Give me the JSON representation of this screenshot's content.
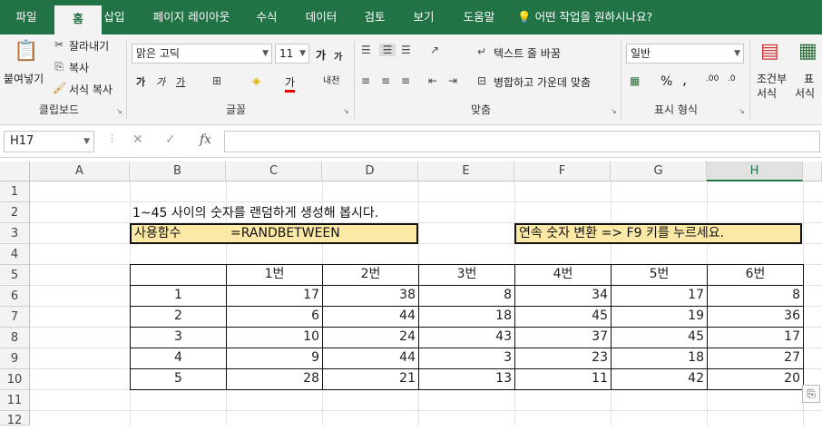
{
  "tabs": [
    "파일",
    "홈",
    "삽입",
    "페이지 레이아웃",
    "수식",
    "데이터",
    "검토",
    "보기",
    "도움말"
  ],
  "tell_me": "어떤 작업을 원하시나요?",
  "clipboard": {
    "paste": "붙여넣기",
    "cut": "잘라내기",
    "copy": "복사",
    "format_painter": "서식 복사",
    "label": "클립보드"
  },
  "font": {
    "name": "맑은 고딕",
    "size": "11",
    "grow": "가",
    "shrink": "가",
    "bold": "가",
    "italic": "가",
    "underline": "가",
    "label": "글꼴",
    "phonetic": "내천"
  },
  "alignment": {
    "wrap": "텍스트 줄 바꿈",
    "merge": "병합하고 가운데 맞춤",
    "label": "맞춤"
  },
  "number": {
    "format": "일반",
    "percent": "%",
    "comma": ",",
    "inc": ".00",
    "dec": ".0",
    "label": "표시 형식"
  },
  "styles": {
    "conditional": "조건부",
    "conditional2": "서식",
    "table": "표",
    "table2": "서식"
  },
  "name_box": "H17",
  "fx": "fx",
  "columns": [
    "A",
    "B",
    "C",
    "D",
    "E",
    "F",
    "G",
    "H"
  ],
  "rows": [
    "1",
    "2",
    "3",
    "4",
    "5",
    "6",
    "7",
    "8",
    "9",
    "10",
    "11",
    "12"
  ],
  "sheet": {
    "title": "1~45 사이의 숫자를 랜덤하게 생성해 봅시다.",
    "func_label": "사용함수",
    "func_name": "=RANDBETWEEN",
    "hint": "연속 숫자 변환 => F9 키를 누르세요.",
    "headers": [
      "1번",
      "2번",
      "3번",
      "4번",
      "5번",
      "6번"
    ],
    "table": [
      {
        "n": "1",
        "v": [
          "17",
          "38",
          "8",
          "34",
          "17",
          "8"
        ]
      },
      {
        "n": "2",
        "v": [
          "6",
          "44",
          "18",
          "45",
          "19",
          "36"
        ]
      },
      {
        "n": "3",
        "v": [
          "10",
          "24",
          "43",
          "37",
          "45",
          "17"
        ]
      },
      {
        "n": "4",
        "v": [
          "9",
          "44",
          "3",
          "23",
          "18",
          "27"
        ]
      },
      {
        "n": "5",
        "v": [
          "28",
          "21",
          "13",
          "11",
          "42",
          "20"
        ]
      }
    ]
  }
}
